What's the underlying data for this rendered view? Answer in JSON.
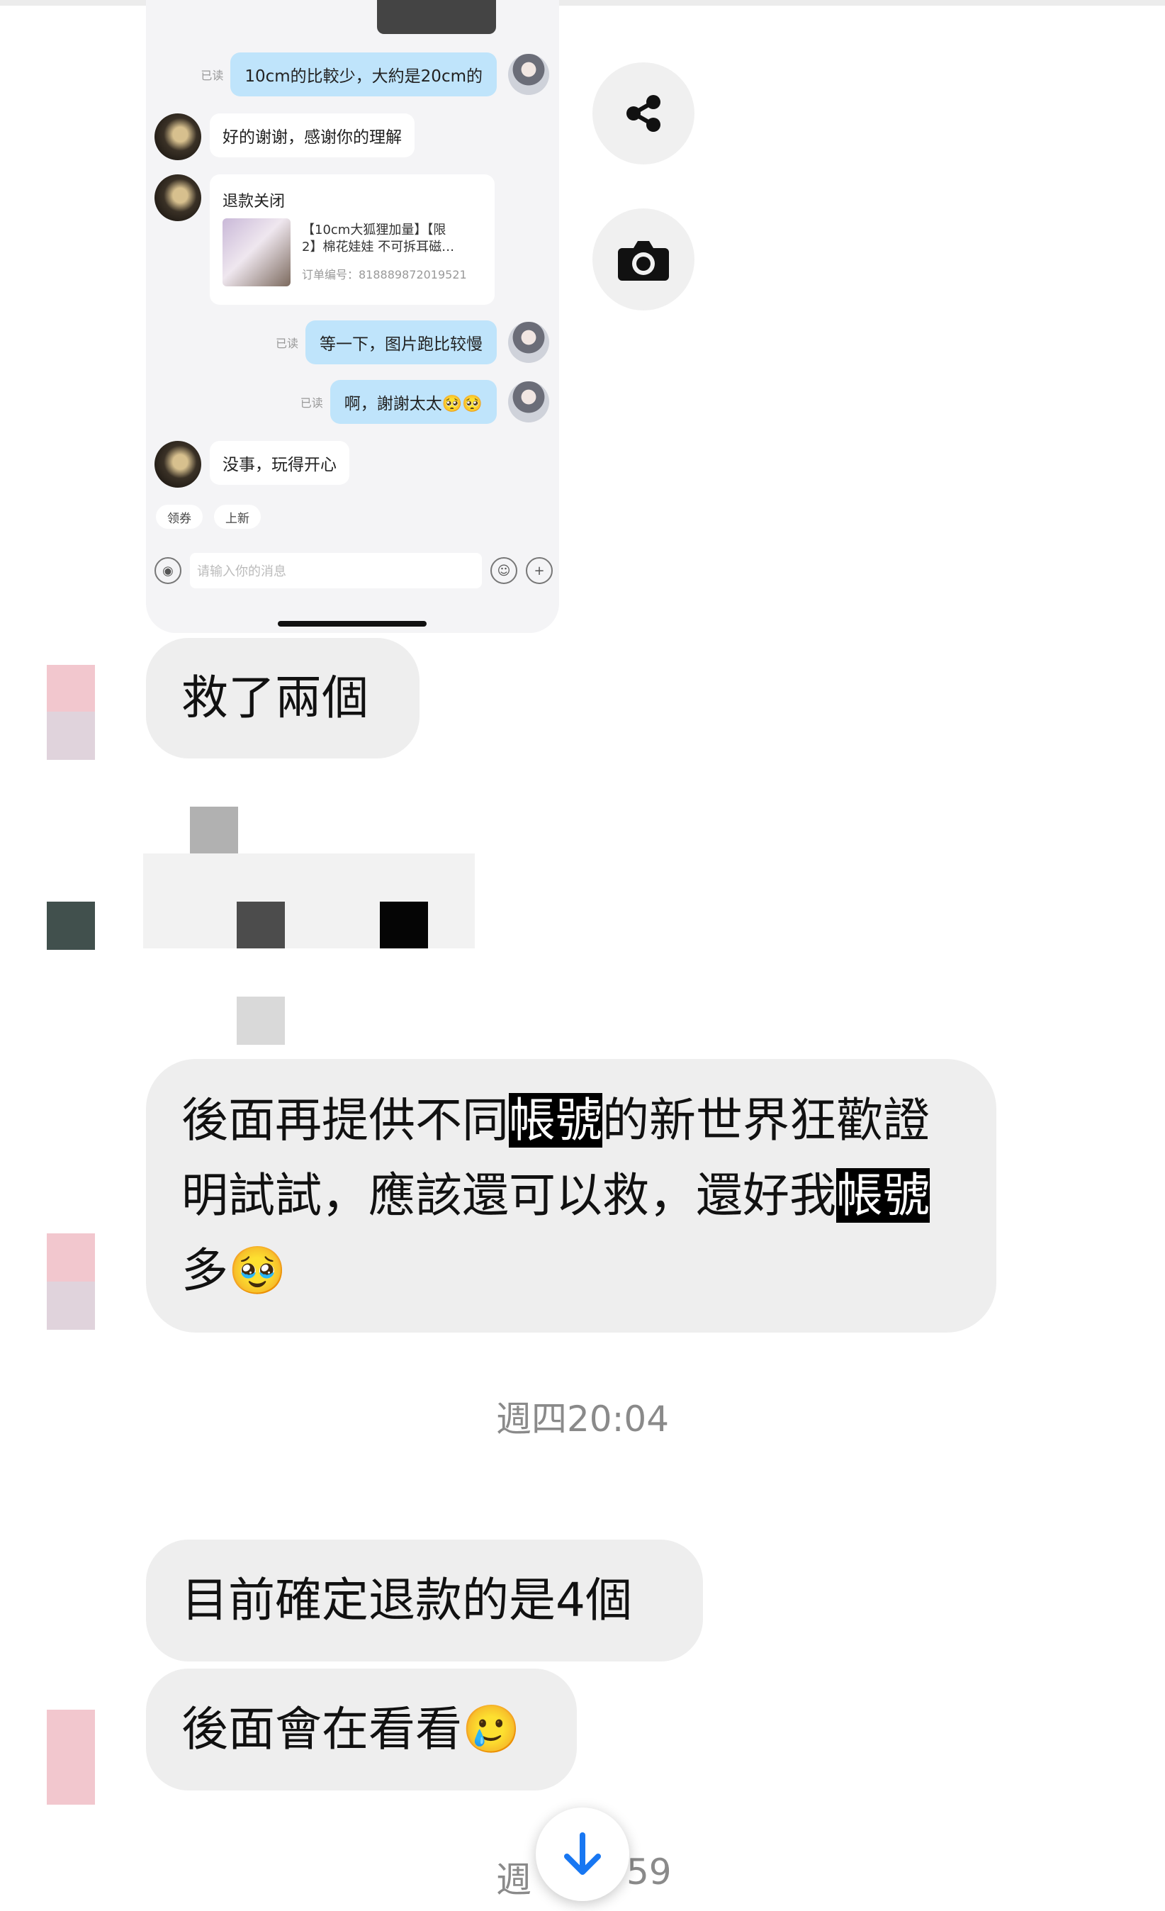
{
  "embedded_screenshot": {
    "messages": [
      {
        "side": "out",
        "read": "已读",
        "text": "10cm的比較少，大約是20cm的"
      },
      {
        "side": "in",
        "text": "好的谢谢，感谢你的理解"
      },
      {
        "side": "in",
        "card": {
          "title": "退款关闭",
          "line1": "【10cm大狐狸加量】【限",
          "line2": "2】棉花娃娃 不可拆耳磁…",
          "order": "订单编号：8188898720195​21"
        }
      },
      {
        "side": "out",
        "read": "已读",
        "text": "等一下，图片跑比较慢"
      },
      {
        "side": "out",
        "read": "已读",
        "text": "啊，謝謝太太🥺🥺"
      },
      {
        "side": "in",
        "text": "没事，玩得开心"
      }
    ],
    "chips": [
      "领券",
      "上新"
    ],
    "input_placeholder": "请输入你的消息"
  },
  "icons": {
    "share": "share-icon",
    "camera": "camera-icon",
    "scroll": "arrow-down-icon"
  },
  "chat": {
    "msg1": "救了兩個",
    "msg2": {
      "part1": "後面再提供不同",
      "hl1": "帳號",
      "part2": "的新世界狂歡證明試試，應該還可以救，還好我",
      "hl2": "帳號",
      "part3": "多",
      "emoji": "🥹"
    },
    "timestamp1": "週四20:04",
    "msg3": "目前確定退款的是4個",
    "msg4": {
      "text": "後面會在看看",
      "emoji": "🥲"
    },
    "timestamp2_left": "週",
    "timestamp2_right": "59"
  }
}
